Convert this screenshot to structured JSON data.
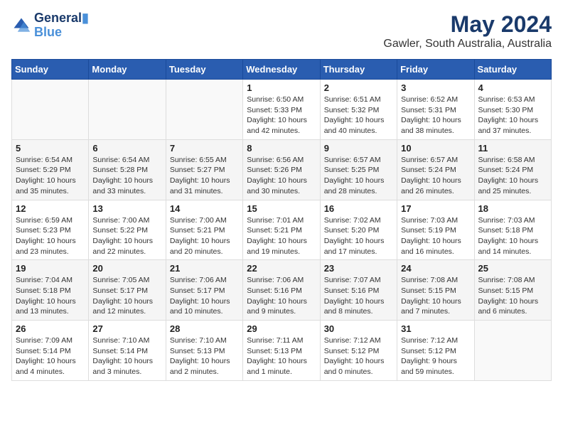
{
  "logo": {
    "line1": "General",
    "line2": "Blue"
  },
  "title": "May 2024",
  "subtitle": "Gawler, South Australia, Australia",
  "headers": [
    "Sunday",
    "Monday",
    "Tuesday",
    "Wednesday",
    "Thursday",
    "Friday",
    "Saturday"
  ],
  "weeks": [
    [
      {
        "day": "",
        "info": ""
      },
      {
        "day": "",
        "info": ""
      },
      {
        "day": "",
        "info": ""
      },
      {
        "day": "1",
        "info": "Sunrise: 6:50 AM\nSunset: 5:33 PM\nDaylight: 10 hours\nand 42 minutes."
      },
      {
        "day": "2",
        "info": "Sunrise: 6:51 AM\nSunset: 5:32 PM\nDaylight: 10 hours\nand 40 minutes."
      },
      {
        "day": "3",
        "info": "Sunrise: 6:52 AM\nSunset: 5:31 PM\nDaylight: 10 hours\nand 38 minutes."
      },
      {
        "day": "4",
        "info": "Sunrise: 6:53 AM\nSunset: 5:30 PM\nDaylight: 10 hours\nand 37 minutes."
      }
    ],
    [
      {
        "day": "5",
        "info": "Sunrise: 6:54 AM\nSunset: 5:29 PM\nDaylight: 10 hours\nand 35 minutes."
      },
      {
        "day": "6",
        "info": "Sunrise: 6:54 AM\nSunset: 5:28 PM\nDaylight: 10 hours\nand 33 minutes."
      },
      {
        "day": "7",
        "info": "Sunrise: 6:55 AM\nSunset: 5:27 PM\nDaylight: 10 hours\nand 31 minutes."
      },
      {
        "day": "8",
        "info": "Sunrise: 6:56 AM\nSunset: 5:26 PM\nDaylight: 10 hours\nand 30 minutes."
      },
      {
        "day": "9",
        "info": "Sunrise: 6:57 AM\nSunset: 5:25 PM\nDaylight: 10 hours\nand 28 minutes."
      },
      {
        "day": "10",
        "info": "Sunrise: 6:57 AM\nSunset: 5:24 PM\nDaylight: 10 hours\nand 26 minutes."
      },
      {
        "day": "11",
        "info": "Sunrise: 6:58 AM\nSunset: 5:24 PM\nDaylight: 10 hours\nand 25 minutes."
      }
    ],
    [
      {
        "day": "12",
        "info": "Sunrise: 6:59 AM\nSunset: 5:23 PM\nDaylight: 10 hours\nand 23 minutes."
      },
      {
        "day": "13",
        "info": "Sunrise: 7:00 AM\nSunset: 5:22 PM\nDaylight: 10 hours\nand 22 minutes."
      },
      {
        "day": "14",
        "info": "Sunrise: 7:00 AM\nSunset: 5:21 PM\nDaylight: 10 hours\nand 20 minutes."
      },
      {
        "day": "15",
        "info": "Sunrise: 7:01 AM\nSunset: 5:21 PM\nDaylight: 10 hours\nand 19 minutes."
      },
      {
        "day": "16",
        "info": "Sunrise: 7:02 AM\nSunset: 5:20 PM\nDaylight: 10 hours\nand 17 minutes."
      },
      {
        "day": "17",
        "info": "Sunrise: 7:03 AM\nSunset: 5:19 PM\nDaylight: 10 hours\nand 16 minutes."
      },
      {
        "day": "18",
        "info": "Sunrise: 7:03 AM\nSunset: 5:18 PM\nDaylight: 10 hours\nand 14 minutes."
      }
    ],
    [
      {
        "day": "19",
        "info": "Sunrise: 7:04 AM\nSunset: 5:18 PM\nDaylight: 10 hours\nand 13 minutes."
      },
      {
        "day": "20",
        "info": "Sunrise: 7:05 AM\nSunset: 5:17 PM\nDaylight: 10 hours\nand 12 minutes."
      },
      {
        "day": "21",
        "info": "Sunrise: 7:06 AM\nSunset: 5:17 PM\nDaylight: 10 hours\nand 10 minutes."
      },
      {
        "day": "22",
        "info": "Sunrise: 7:06 AM\nSunset: 5:16 PM\nDaylight: 10 hours\nand 9 minutes."
      },
      {
        "day": "23",
        "info": "Sunrise: 7:07 AM\nSunset: 5:16 PM\nDaylight: 10 hours\nand 8 minutes."
      },
      {
        "day": "24",
        "info": "Sunrise: 7:08 AM\nSunset: 5:15 PM\nDaylight: 10 hours\nand 7 minutes."
      },
      {
        "day": "25",
        "info": "Sunrise: 7:08 AM\nSunset: 5:15 PM\nDaylight: 10 hours\nand 6 minutes."
      }
    ],
    [
      {
        "day": "26",
        "info": "Sunrise: 7:09 AM\nSunset: 5:14 PM\nDaylight: 10 hours\nand 4 minutes."
      },
      {
        "day": "27",
        "info": "Sunrise: 7:10 AM\nSunset: 5:14 PM\nDaylight: 10 hours\nand 3 minutes."
      },
      {
        "day": "28",
        "info": "Sunrise: 7:10 AM\nSunset: 5:13 PM\nDaylight: 10 hours\nand 2 minutes."
      },
      {
        "day": "29",
        "info": "Sunrise: 7:11 AM\nSunset: 5:13 PM\nDaylight: 10 hours\nand 1 minute."
      },
      {
        "day": "30",
        "info": "Sunrise: 7:12 AM\nSunset: 5:12 PM\nDaylight: 10 hours\nand 0 minutes."
      },
      {
        "day": "31",
        "info": "Sunrise: 7:12 AM\nSunset: 5:12 PM\nDaylight: 9 hours\nand 59 minutes."
      },
      {
        "day": "",
        "info": ""
      }
    ]
  ]
}
